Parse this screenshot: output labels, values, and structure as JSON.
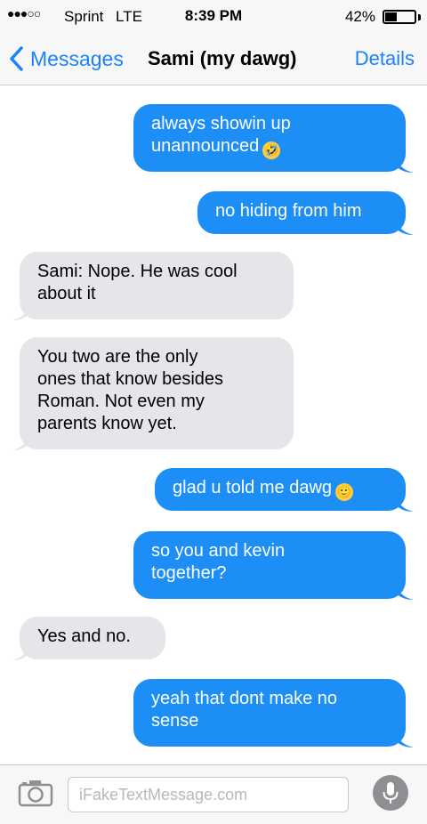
{
  "status_bar": {
    "signal": "●●●○○",
    "carrier": "Sprint",
    "network": "LTE",
    "time": "8:39 PM",
    "battery_percent": "42%",
    "battery_level": 0.42
  },
  "nav": {
    "back_label": "Messages",
    "contact_name": "Sami (my dawg)",
    "details_label": "Details"
  },
  "messages": [
    {
      "direction": "out",
      "lines": [
        "always showin up",
        "unannounced"
      ],
      "emoji": "rolling-on-floor-laughing"
    },
    {
      "direction": "out",
      "lines": [
        "no hiding from him"
      ]
    },
    {
      "direction": "in",
      "lines": [
        "Sami: Nope. He was cool",
        "about it"
      ]
    },
    {
      "direction": "in",
      "lines": [
        "You two are the only",
        "ones that know besides",
        "Roman. Not even my",
        "parents know yet."
      ]
    },
    {
      "direction": "out",
      "lines": [
        "glad u told me dawg"
      ],
      "emoji": "slightly-smiling-face"
    },
    {
      "direction": "out",
      "lines": [
        "so you and kevin",
        "together?"
      ]
    },
    {
      "direction": "in",
      "lines": [
        "Yes and no."
      ]
    },
    {
      "direction": "out",
      "lines": [
        "yeah that dont make no",
        "sense"
      ]
    }
  ],
  "input": {
    "placeholder": "iFakeTextMessage.com"
  },
  "colors": {
    "accent": "#1a82fb",
    "outgoing_bubble": "#1d8ef5",
    "incoming_bubble": "#e5e5ea"
  },
  "icons": {
    "back": "chevron-left-icon",
    "camera": "camera-icon",
    "mic": "microphone-icon"
  }
}
